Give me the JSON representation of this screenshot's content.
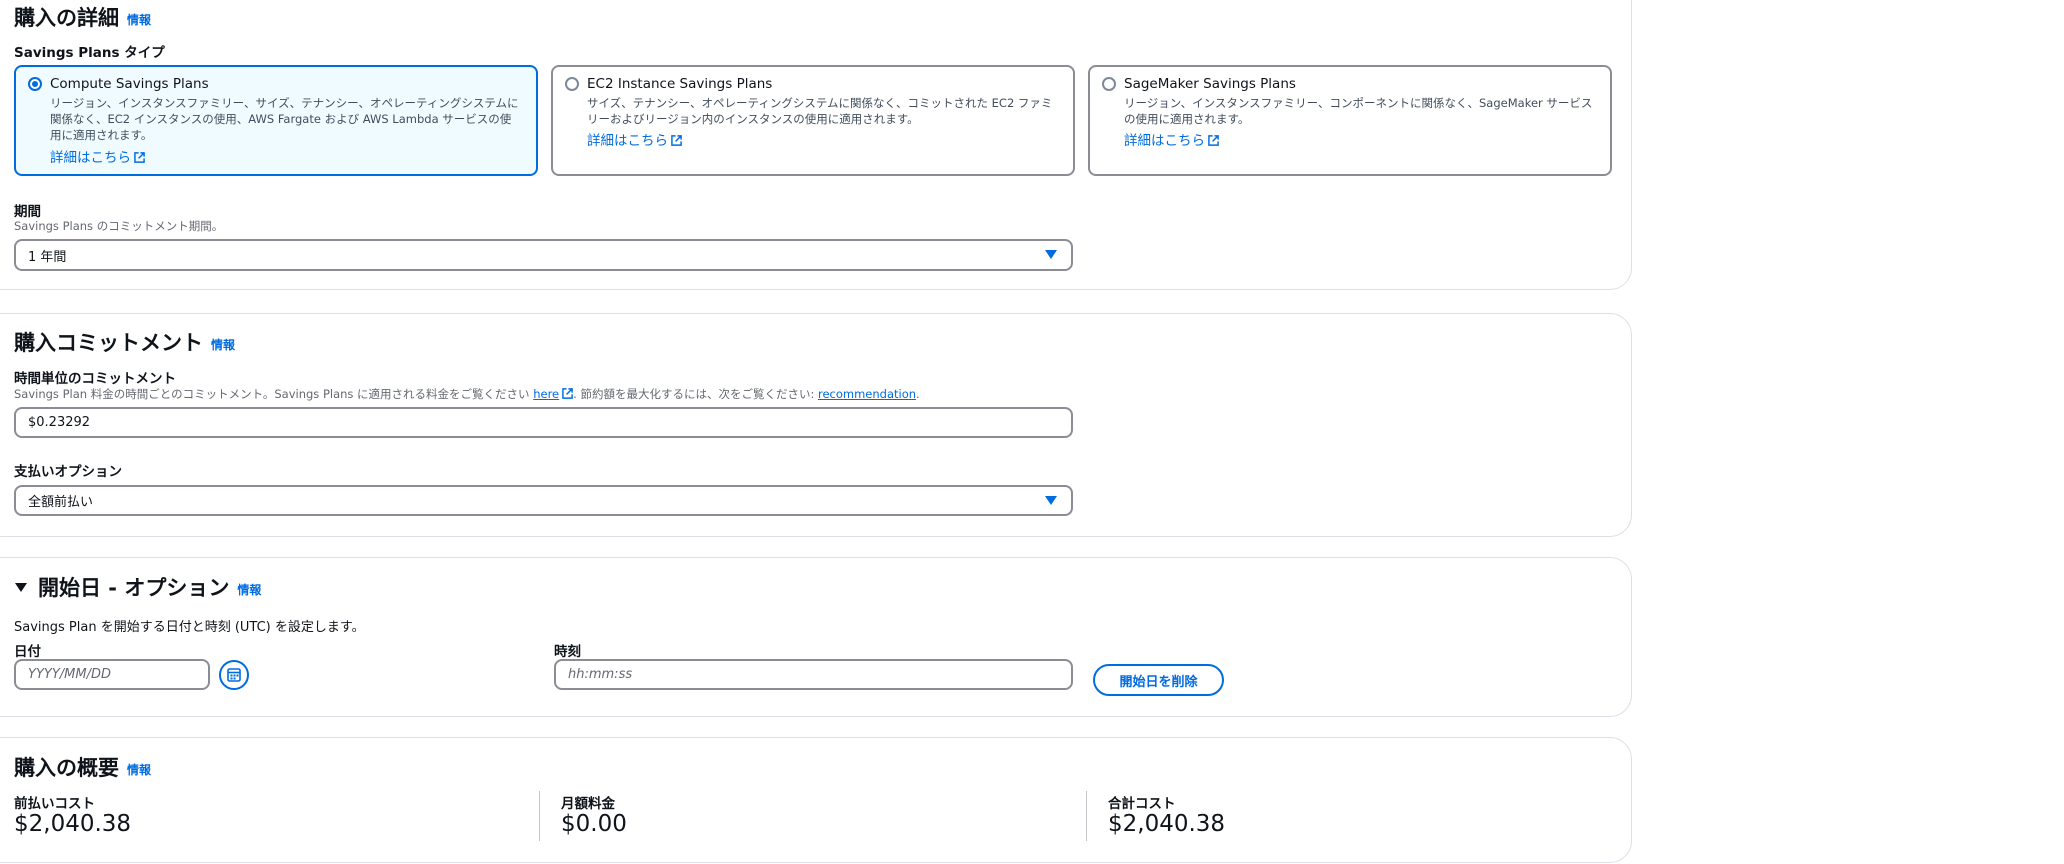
{
  "purchase_details": {
    "heading": "購入の詳細",
    "info": "情報",
    "plan_type_label": "Savings Plans タイプ",
    "plan_types": [
      {
        "title": "Compute Savings Plans",
        "description": "リージョン、インスタンスファミリー、サイズ、テナンシー、オペレーティングシステムに関係なく、EC2 インスタンスの使用、AWS Fargate および AWS Lambda サービスの使用に適用されます。",
        "link": "詳細はこちら",
        "selected": true
      },
      {
        "title": "EC2 Instance Savings Plans",
        "description": "サイズ、テナンシー、オペレーティングシステムに関係なく、コミットされた EC2 ファミリーおよびリージョン内のインスタンスの使用に適用されます。",
        "link": "詳細はこちら",
        "selected": false
      },
      {
        "title": "SageMaker Savings Plans",
        "description": "リージョン、インスタンスファミリー、コンポーネントに関係なく、SageMaker サービスの使用に適用されます。",
        "link": "詳細はこちら",
        "selected": false
      }
    ],
    "term_label": "期間",
    "term_description": "Savings Plans のコミットメント期間。",
    "term_value": "1 年間"
  },
  "commitment": {
    "heading": "購入コミットメント",
    "info": "情報",
    "hourly_label": "時間単位のコミットメント",
    "hourly_desc_prefix": "Savings Plan 料金の時間ごとのコミットメント。Savings Plans に適用される料金をご覧ください ",
    "hourly_desc_here": "here",
    "hourly_desc_middle": ". 節約額を最大化するには、次をご覧ください: ",
    "hourly_desc_recommendation": "recommendation",
    "hourly_desc_suffix": ".",
    "hourly_value": "$0.23292",
    "payment_label": "支払いオプション",
    "payment_value": "全額前払い"
  },
  "start_date": {
    "heading": "開始日 - オプション",
    "info": "情報",
    "description": "Savings Plan を開始する日付と時刻 (UTC) を設定します。",
    "date_label": "日付",
    "date_placeholder": "YYYY/MM/DD",
    "time_label": "時刻",
    "time_placeholder": "hh:mm:ss",
    "remove_button": "開始日を削除"
  },
  "summary": {
    "heading": "購入の概要",
    "info": "情報",
    "items": [
      {
        "label": "前払いコスト",
        "value": "$2,040.38"
      },
      {
        "label": "月額料金",
        "value": "$0.00"
      },
      {
        "label": "合計コスト",
        "value": "$2,040.38"
      }
    ]
  },
  "colors": {
    "link": "#006ce0",
    "selected_bg": "#f0fbff",
    "border": "#8c8c94"
  }
}
